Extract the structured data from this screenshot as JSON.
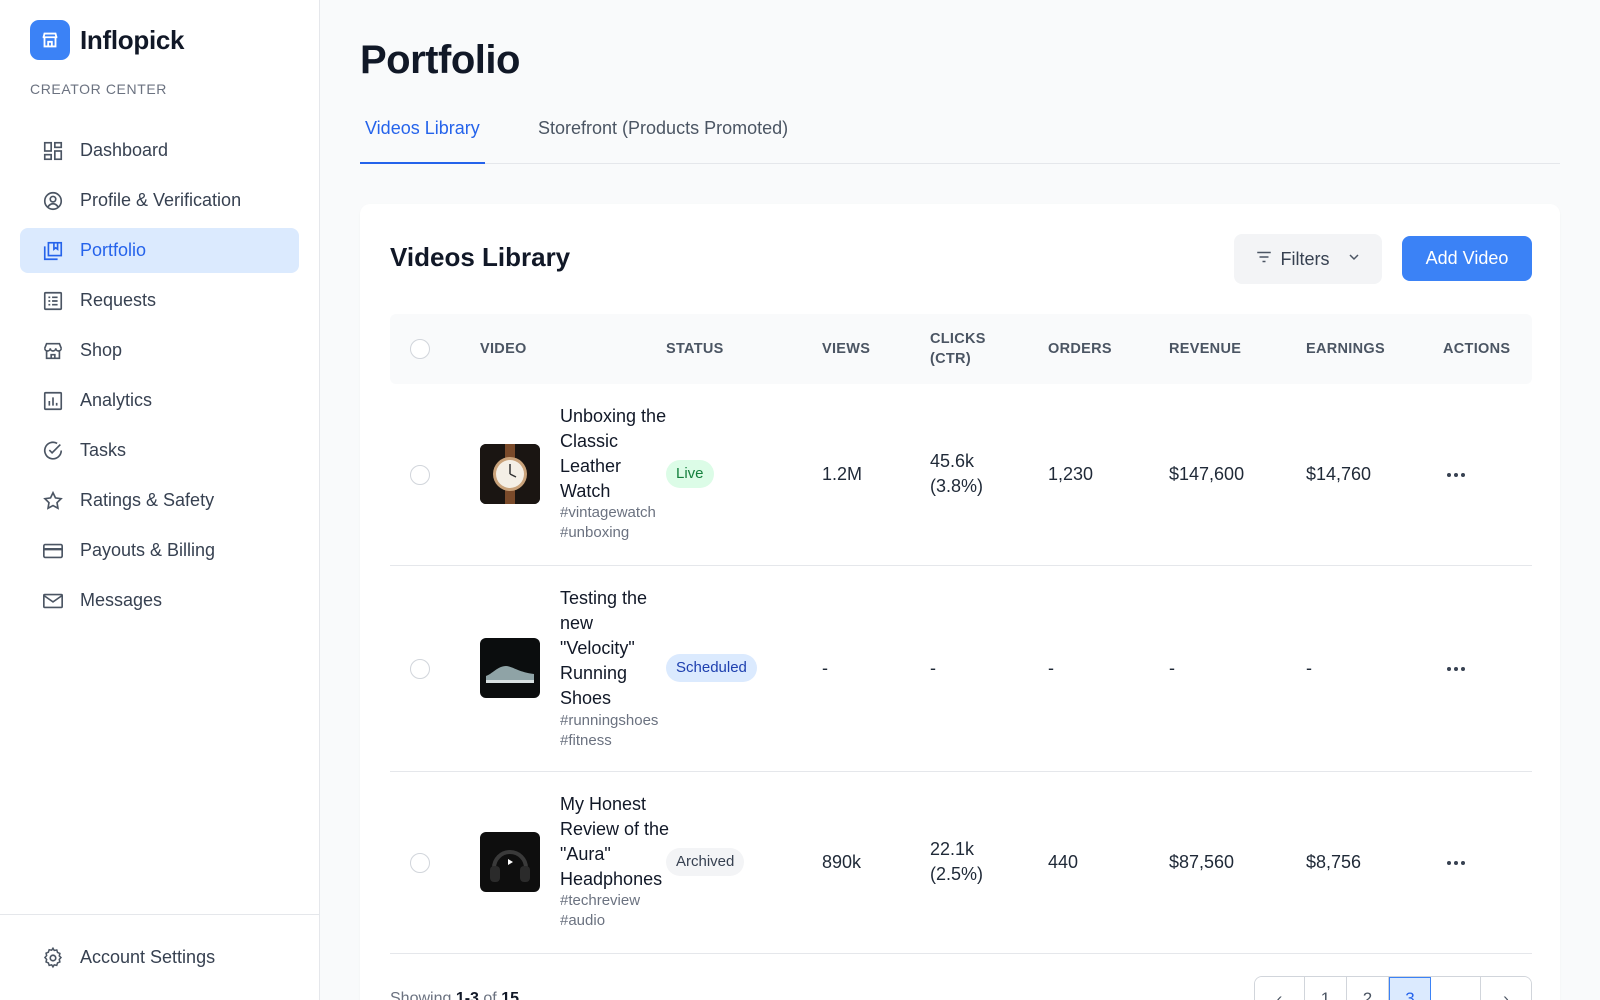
{
  "brand": {
    "name": "Inflopick",
    "section_label": "CREATOR CENTER"
  },
  "sidebar": {
    "items": [
      {
        "label": "Dashboard",
        "icon": "dashboard-icon",
        "active": false
      },
      {
        "label": "Profile & Verification",
        "icon": "user-circle-icon",
        "active": false
      },
      {
        "label": "Portfolio",
        "icon": "portfolio-icon",
        "active": true
      },
      {
        "label": "Requests",
        "icon": "list-icon",
        "active": false
      },
      {
        "label": "Shop",
        "icon": "store-icon",
        "active": false
      },
      {
        "label": "Analytics",
        "icon": "chart-icon",
        "active": false
      },
      {
        "label": "Tasks",
        "icon": "check-circle-icon",
        "active": false
      },
      {
        "label": "Ratings & Safety",
        "icon": "star-icon",
        "active": false
      },
      {
        "label": "Payouts & Billing",
        "icon": "credit-card-icon",
        "active": false
      },
      {
        "label": "Messages",
        "icon": "mail-icon",
        "active": false
      }
    ],
    "settings_label": "Account Settings"
  },
  "page": {
    "title": "Portfolio",
    "tabs": [
      {
        "label": "Videos Library",
        "active": true
      },
      {
        "label": "Storefront (Products Promoted)",
        "active": false
      }
    ]
  },
  "card": {
    "title": "Videos Library",
    "filters_label": "Filters",
    "add_label": "Add Video"
  },
  "table": {
    "headers": {
      "video": "VIDEO",
      "status": "STATUS",
      "views": "VIEWS",
      "clicks": "CLICKS (CTR)",
      "orders": "ORDERS",
      "revenue": "REVENUE",
      "earnings": "EARNINGS",
      "actions": "ACTIONS"
    },
    "rows": [
      {
        "title": "Unboxing the Classic Leather Watch",
        "tags": "#vintagewatch #unboxing",
        "status": "Live",
        "views": "1.2M",
        "clicks": "45.6k (3.8%)",
        "orders": "1,230",
        "revenue": "$147,600",
        "earnings": "$14,760",
        "thumb": "watch"
      },
      {
        "title": "Testing the new \"Velocity\" Running Shoes",
        "tags": "#runningshoes #fitness",
        "status": "Scheduled",
        "views": "-",
        "clicks": "-",
        "orders": "-",
        "revenue": "-",
        "earnings": "-",
        "thumb": "shoe"
      },
      {
        "title": "My Honest Review of the \"Aura\" Headphones",
        "tags": "#techreview #audio",
        "status": "Archived",
        "views": "890k",
        "clicks": "22.1k (2.5%)",
        "orders": "440",
        "revenue": "$87,560",
        "earnings": "$8,756",
        "thumb": "headphones"
      }
    ]
  },
  "pagination": {
    "showing_prefix": "Showing",
    "range": "1-3",
    "of": "of",
    "total": "15",
    "pages": [
      "1",
      "2",
      "3",
      ""
    ],
    "current": "3",
    "prev": "‹",
    "next": "›"
  },
  "colors": {
    "accent": "#3b82f6",
    "active_bg": "#dbeafe",
    "live": "#15803d",
    "scheduled": "#1e40af"
  }
}
